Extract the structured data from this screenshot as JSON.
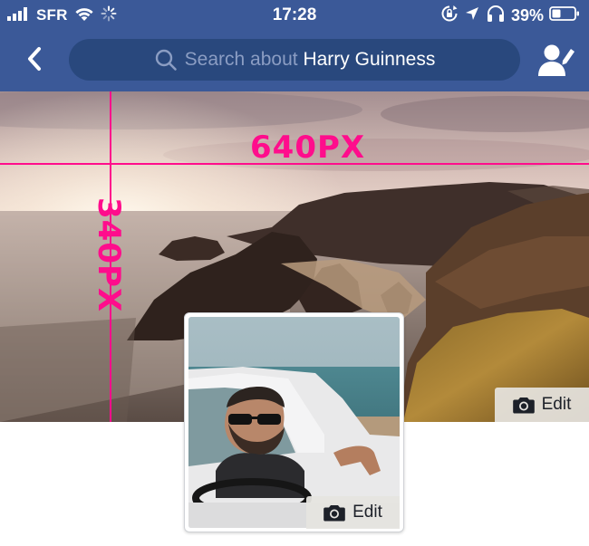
{
  "status_bar": {
    "carrier": "SFR",
    "time": "17:28",
    "battery_percent": "39%",
    "icons": [
      "signal-bars-icon",
      "wifi-icon",
      "activity-spinner-icon",
      "orientation-lock-icon",
      "location-arrow-icon",
      "headphones-icon",
      "battery-icon"
    ]
  },
  "nav": {
    "back_icon": "chevron-left-icon",
    "search_prefix": "Search about",
    "search_name": "Harry Guinness",
    "search_icon": "search-icon",
    "profile_edit_icon": "edit-profile-icon"
  },
  "cover": {
    "width_label": "640PX",
    "height_label": "340PX",
    "edit_label": "Edit",
    "edit_icon": "camera-icon"
  },
  "profile_picture": {
    "edit_label": "Edit",
    "edit_icon": "camera-icon"
  },
  "colors": {
    "header_blue": "#3b5998",
    "search_bg": "#29487d",
    "guide_pink": "#ff0d8c"
  }
}
